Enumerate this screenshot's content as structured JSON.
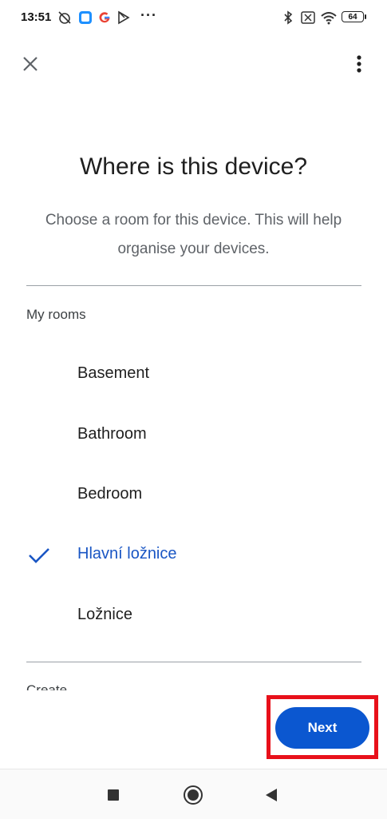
{
  "status_bar": {
    "time": "13:51",
    "icons": [
      "alarm-off-icon",
      "messenger-icon",
      "google-icon",
      "play-store-icon",
      "bluetooth-icon",
      "no-sim-icon",
      "wifi-icon"
    ],
    "more": "···",
    "battery": "64"
  },
  "app_bar": {
    "close_icon": "close-icon",
    "more_icon": "more-vert-icon"
  },
  "header": {
    "title": "Where is this device?",
    "subtitle": "Choose a room for this device. This will help organise your devices."
  },
  "rooms_section": {
    "label": "My rooms",
    "items": [
      {
        "label": "Basement",
        "selected": false
      },
      {
        "label": "Bathroom",
        "selected": false
      },
      {
        "label": "Bedroom",
        "selected": false
      },
      {
        "label": "Hlavní ložnice",
        "selected": true
      },
      {
        "label": "Ložnice",
        "selected": false
      }
    ]
  },
  "next_section_label_partial": "Create",
  "footer": {
    "next_label": "Next"
  },
  "colors": {
    "accent": "#0b57d0",
    "selected_text": "#1a56c4",
    "highlight": "#e8101a"
  },
  "nav_bar": {
    "icons": [
      "recents-square-icon",
      "home-circle-icon",
      "back-triangle-icon"
    ]
  }
}
